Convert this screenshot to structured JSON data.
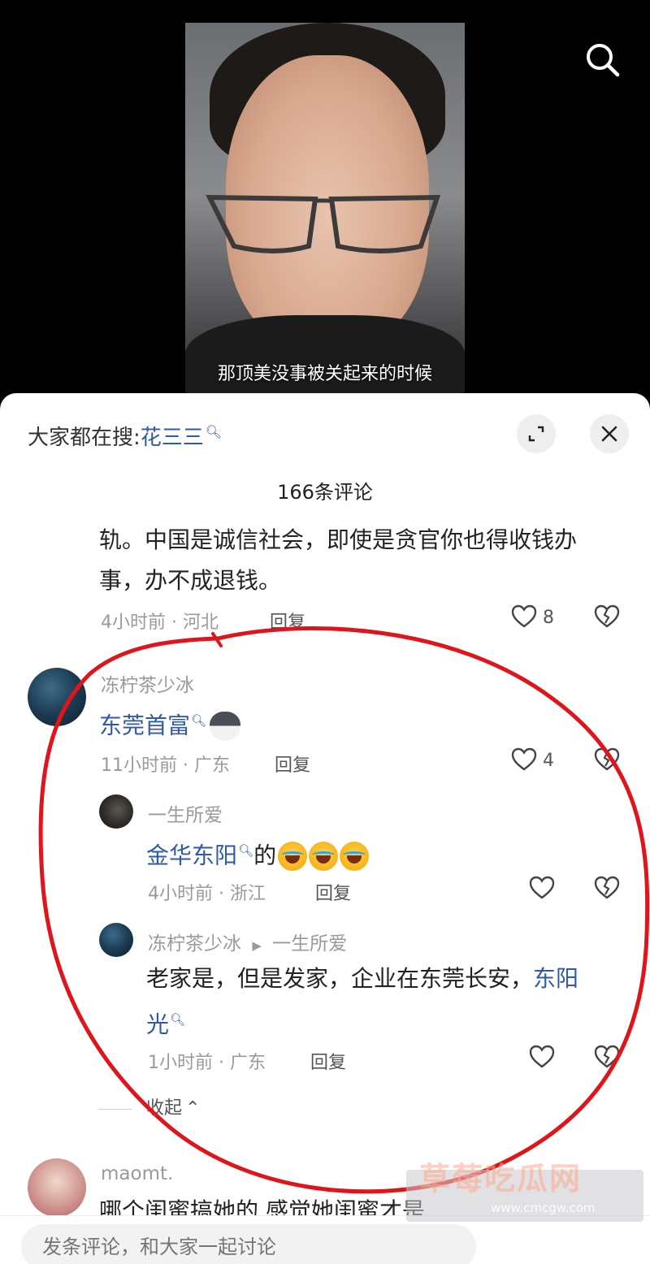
{
  "video": {
    "subtitle": "那顶美没事被关起来的时候"
  },
  "sheet": {
    "search_prefix": "大家都在搜:",
    "search_keyword": "花三三",
    "comment_count": "166条评论"
  },
  "comments": {
    "top_partial": {
      "text_line1": "轨。中国是诚信社会，即使是贪官你也得收钱办",
      "text_line2": "事，办不成退钱。",
      "meta": "4小时前 · 河北",
      "reply": "回复",
      "likes": "8"
    },
    "main": {
      "user": "冻柠茶少冰",
      "link_text": "东莞首富",
      "meta": "11小时前 · 广东",
      "reply": "回复",
      "likes": "4"
    },
    "reply1": {
      "user": "一生所爱",
      "link_text": "金华东阳",
      "suffix": "的",
      "meta": "4小时前 · 浙江",
      "reply": "回复"
    },
    "reply2": {
      "user": "冻柠茶少冰",
      "reply_to": "一生所爱",
      "text_line1": "老家是，但是发家，企业在东莞长安，",
      "link_text_part1": "东阳",
      "link_text_part2": "光",
      "meta": "1小时前 · 广东",
      "reply": "回复"
    },
    "collapse_label": "收起",
    "next": {
      "user": "maomt.",
      "text": "哪个闺蜜搞她的 感觉她闺蜜才是"
    }
  },
  "input": {
    "placeholder": "发条评论，和大家一起讨论"
  },
  "watermark": {
    "title": "草莓吃瓜网",
    "url": "www.cmcgw.com"
  },
  "colors": {
    "link": "#2f5aa8",
    "annotation": "#e0141b"
  }
}
